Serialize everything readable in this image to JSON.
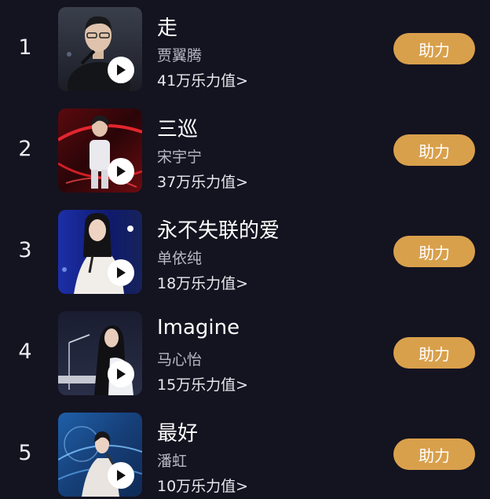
{
  "ranking": [
    {
      "rank": "1",
      "song": "走",
      "singer": "贾翼腾",
      "power": "41万乐力值>",
      "button": "助力"
    },
    {
      "rank": "2",
      "song": "三巡",
      "singer": "宋宇宁",
      "power": "37万乐力值>",
      "button": "助力"
    },
    {
      "rank": "3",
      "song": "永不失联的爱",
      "singer": "单依纯",
      "power": "18万乐力值>",
      "button": "助力"
    },
    {
      "rank": "4",
      "song": "Imagine",
      "singer": "马心怡",
      "power": "15万乐力值>",
      "button": "助力"
    },
    {
      "rank": "5",
      "song": "最好",
      "singer": "潘虹",
      "power": "10万乐力值>",
      "button": "助力"
    }
  ],
  "colors": {
    "background": "#141320",
    "button": "#d9a04c",
    "singer_text": "#b9b7c4"
  },
  "icons": {
    "play": "play-icon"
  }
}
